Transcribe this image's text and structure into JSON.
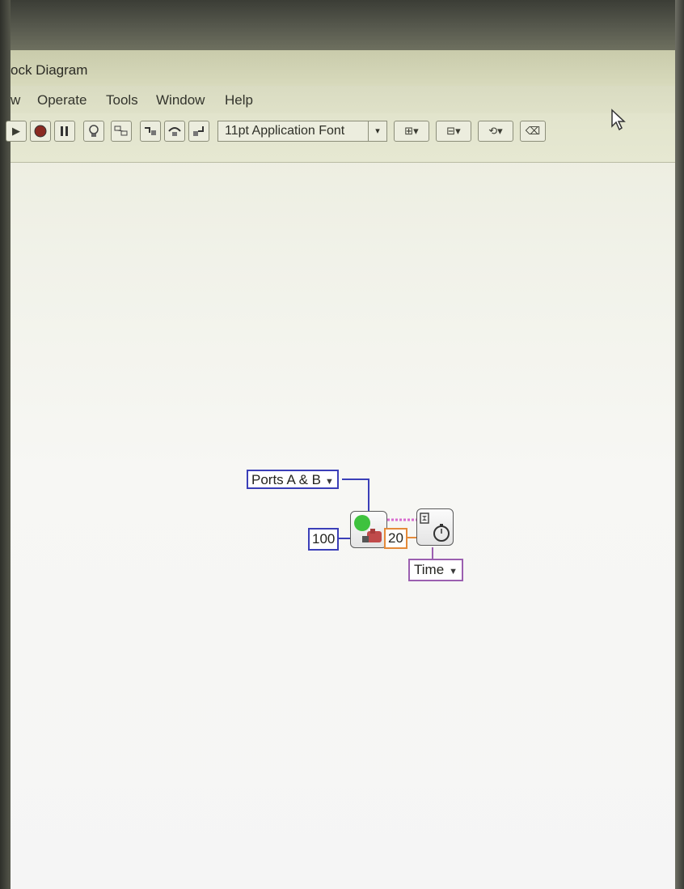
{
  "window": {
    "title": "ock Diagram"
  },
  "menu": {
    "items": [
      "w",
      "Operate",
      "Tools",
      "Window",
      "Help"
    ]
  },
  "toolbar": {
    "buttons": [
      "run-button",
      "abort-button",
      "pause-button",
      "highlight-button",
      "retain-wire-button",
      "step-into-button",
      "step-over-button",
      "step-out-button"
    ],
    "font_ring": "11pt Application Font",
    "tools": [
      "align-objects-icon",
      "distribute-objects-icon",
      "reorder-icon",
      "cleanup-diagram-icon"
    ]
  },
  "diagram": {
    "ports_ring": "Ports A & B",
    "speed_constant": "100",
    "degrees_constant": "20",
    "wait_ring": "Time",
    "motor_block": "motor-block-icon",
    "wait_block": "wait-timer-icon",
    "colors": {
      "enum_wire": "#3b3fb8",
      "numeric_wire_orange": "#e48a3a",
      "cluster_wire_pink": "#d86cd0",
      "ring_purple": "#9b5fb0",
      "status_green": "#3ec23e"
    }
  }
}
